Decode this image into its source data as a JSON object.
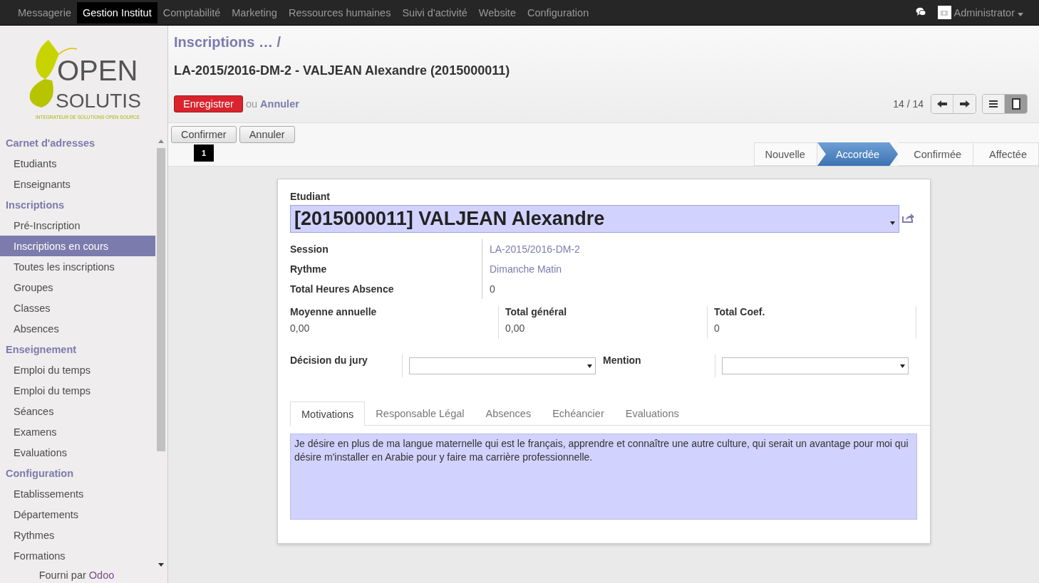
{
  "top_menu": [
    {
      "label": "Messagerie",
      "selected": false
    },
    {
      "label": "Gestion Institut",
      "selected": true
    },
    {
      "label": "Comptabilité",
      "selected": false
    },
    {
      "label": "Marketing",
      "selected": false
    },
    {
      "label": "Ressources humaines",
      "selected": false
    },
    {
      "label": "Suivi d'activité",
      "selected": false
    },
    {
      "label": "Website",
      "selected": false
    },
    {
      "label": "Configuration",
      "selected": false
    }
  ],
  "user": {
    "name": "Administrator"
  },
  "logo": {
    "line1": "OPEN",
    "line2": "SOLUTIS",
    "tagline": "INTEGRATEUR DE SOLUTIONS OPEN SOURCE"
  },
  "sidebar": {
    "sections": [
      {
        "title": "Carnet d'adresses",
        "items": [
          {
            "label": "Etudiants",
            "selected": false
          },
          {
            "label": "Enseignants",
            "selected": false
          }
        ]
      },
      {
        "title": "Inscriptions",
        "items": [
          {
            "label": "Pré-Inscription",
            "selected": false
          },
          {
            "label": "Inscriptions en cours",
            "selected": true
          },
          {
            "label": "Toutes les inscriptions",
            "selected": false
          },
          {
            "label": "Groupes",
            "selected": false
          },
          {
            "label": "Classes",
            "selected": false
          },
          {
            "label": "Absences",
            "selected": false
          }
        ]
      },
      {
        "title": "Enseignement",
        "items": [
          {
            "label": "Emploi du temps",
            "selected": false
          },
          {
            "label": "Emploi du temps",
            "selected": false
          },
          {
            "label": "Séances",
            "selected": false
          },
          {
            "label": "Examens",
            "selected": false
          },
          {
            "label": "Evaluations",
            "selected": false
          }
        ]
      },
      {
        "title": "Configuration",
        "items": [
          {
            "label": "Etablissements",
            "selected": false
          },
          {
            "label": "Départements",
            "selected": false
          },
          {
            "label": "Rythmes",
            "selected": false
          },
          {
            "label": "Formations",
            "selected": false
          }
        ]
      }
    ],
    "footer_prefix": "Fourni par",
    "footer_brand": "Odoo"
  },
  "breadcrumb": "Inscriptions … /",
  "record_title": "LA-2015/2016-DM-2 - VALJEAN Alexandre (2015000011)",
  "save_button": "Enregistrer",
  "or_text": "ou",
  "discard_link": "Annuler",
  "pager": "14 / 14",
  "view_switch": [
    {
      "kind": "list",
      "selected": false
    },
    {
      "kind": "form",
      "selected": true
    }
  ],
  "action_buttons": [
    "Confirmer",
    "Annuler"
  ],
  "badge": "1",
  "status_steps": [
    {
      "label": "Nouvelle",
      "selected": false
    },
    {
      "label": "Accordée",
      "selected": true
    },
    {
      "label": "Confirmée",
      "selected": false
    },
    {
      "label": "Affectée",
      "selected": false
    }
  ],
  "form": {
    "student_label": "Etudiant",
    "student_value": "[2015000011] VALJEAN Alexandre",
    "info": [
      {
        "label": "Session",
        "value": "LA-2015/2016-DM-2",
        "kind": "link"
      },
      {
        "label": "Rythme",
        "value": "Dimanche Matin",
        "kind": "link"
      },
      {
        "label": "Total Heures Absence",
        "value": "0",
        "kind": "text"
      }
    ],
    "totals": [
      {
        "label": "Moyenne annuelle",
        "value": "0,00"
      },
      {
        "label": "Total général",
        "value": "0,00"
      },
      {
        "label": "Total Coef.",
        "value": "0"
      }
    ],
    "selects": [
      {
        "label": "Décision du jury"
      },
      {
        "label": "Mention"
      }
    ],
    "tabs": [
      {
        "label": "Motivations",
        "selected": true
      },
      {
        "label": "Responsable Légal",
        "selected": false
      },
      {
        "label": "Absences",
        "selected": false
      },
      {
        "label": "Echéancier",
        "selected": false
      },
      {
        "label": "Evaluations",
        "selected": false
      }
    ],
    "motivation": "Je désire en plus de ma langue maternelle qui est le français, apprendre et connaître une autre culture, qui serait un avantage pour moi qui désire m'installer en Arabie pour y faire ma carrière professionnelle."
  }
}
